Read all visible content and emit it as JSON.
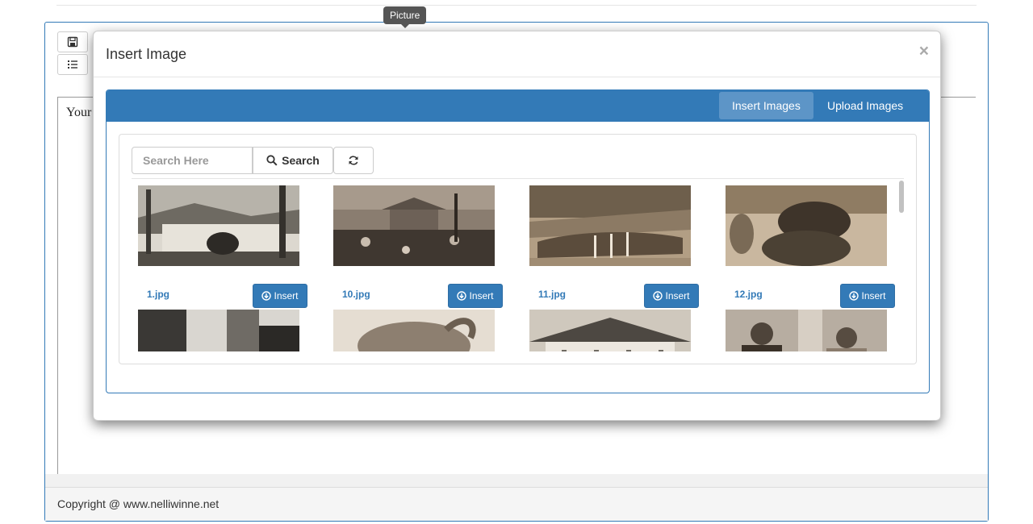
{
  "editor": {
    "body_text": "Your",
    "footer_text": "Copyright @ www.nelliwinne.net"
  },
  "tooltip": {
    "text": "Picture"
  },
  "modal": {
    "title": "Insert Image",
    "close_label": "×",
    "tabs": [
      {
        "label": "Insert Images",
        "active": true
      },
      {
        "label": "Upload Images",
        "active": false
      }
    ],
    "search": {
      "placeholder": "Search Here",
      "value": "",
      "button_label": "Search"
    },
    "images": [
      {
        "filename": "1.jpg",
        "insert_label": "Insert"
      },
      {
        "filename": "10.jpg",
        "insert_label": "Insert"
      },
      {
        "filename": "11.jpg",
        "insert_label": "Insert"
      },
      {
        "filename": "12.jpg",
        "insert_label": "Insert"
      }
    ]
  },
  "colors": {
    "primary": "#337ab7",
    "tab_active": "#5d95c7",
    "tooltip_bg": "#555555"
  },
  "icons": [
    "save-icon",
    "list-icon",
    "search-icon",
    "refresh-icon",
    "download-circle-icon",
    "close-icon"
  ]
}
